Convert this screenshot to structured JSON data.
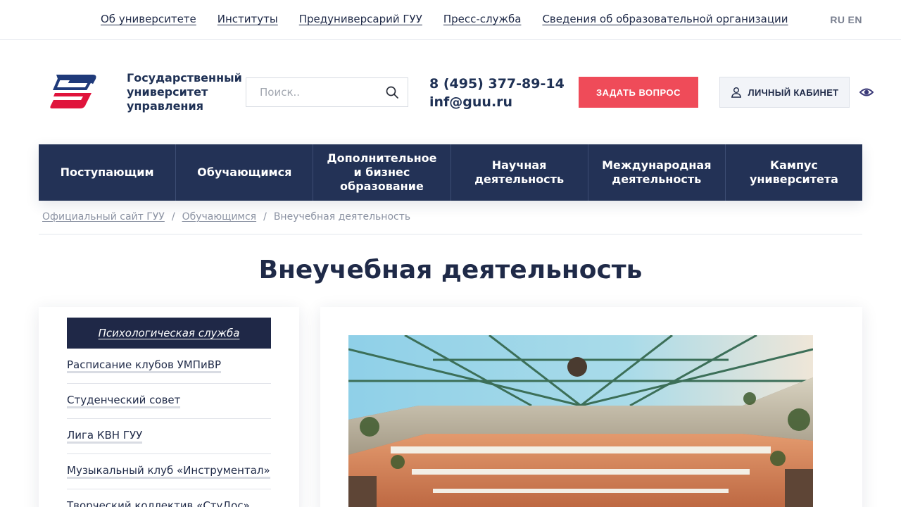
{
  "topbar": {
    "links": [
      "Об университете",
      "Институты",
      "Предуниверсарий ГУУ",
      "Пресс-служба",
      "Сведения об образовательной организации"
    ],
    "lang_ru": "RU",
    "lang_en": "EN"
  },
  "header": {
    "logo_icon": "guu-logo",
    "name_line1": "Государственный",
    "name_line2": "университет",
    "name_line3": "управления",
    "search_placeholder": "Поиск..",
    "search_icon": "search-icon",
    "phone": "8 (495) 377-89-14",
    "email": "inf@guu.ru",
    "ask_label": "ЗАДАТЬ ВОПРОС",
    "cabinet_label": "ЛИЧНЫЙ КАБИНЕТ",
    "cabinet_icon": "user-icon",
    "accessibility_icon": "eye-icon"
  },
  "nav": {
    "items": [
      "Поступающим",
      "Обучающимся",
      "Дополнительное\nи бизнес\nобразование",
      "Научная\nдеятельность",
      "Международная\nдеятельность",
      "Кампус\nуниверситета"
    ]
  },
  "breadcrumb": {
    "home": "Официальный сайт ГУУ",
    "section": "Обучающимся",
    "current": "Внеучебная деятельность",
    "separator": "/"
  },
  "page": {
    "title": "Внеучебная деятельность"
  },
  "sidebar": {
    "active": "Психологическая служба",
    "items": [
      "Расписание клубов УМПиВР",
      "Студенческий совет",
      "Лига КВН ГУУ",
      "Музыкальный клуб «Инструментал»",
      "Творческий коллектив «СтуДос»"
    ]
  },
  "colors": {
    "nav_bg": "#233256",
    "accent_red": "#ef4b59",
    "text_dark": "#1f2a48"
  }
}
